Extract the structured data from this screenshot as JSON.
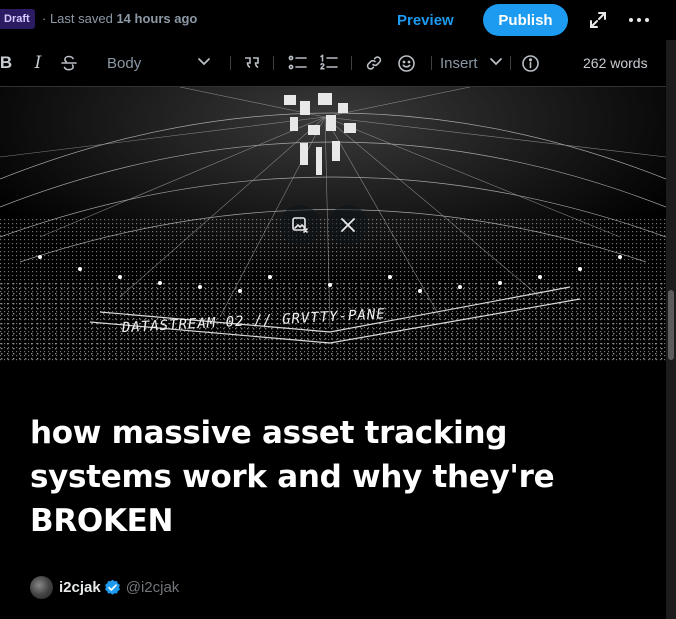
{
  "header": {
    "draft_badge": "Draft",
    "saved_prefix": "· Last saved",
    "saved_time": "14 hours ago",
    "preview_label": "Preview",
    "publish_label": "Publish",
    "accent_color": "#1d9bf0"
  },
  "toolbar": {
    "bold_label": "B",
    "italic_label": "I",
    "style_select": "Body",
    "insert_label": "Insert",
    "word_count": "262 words",
    "icons": [
      "bold-icon",
      "italic-icon",
      "strikethrough-icon",
      "chevron-down-icon",
      "quote-icon",
      "bulleted-list-icon",
      "numbered-list-icon",
      "link-icon",
      "emoji-icon",
      "chevron-down-icon",
      "info-icon"
    ]
  },
  "hero": {
    "image_caption": "DATASTREAM 02 // GRVTTY-PANE",
    "overlay_icons": [
      "edit-media-icon",
      "close-icon"
    ]
  },
  "article": {
    "title": "how massive asset tracking systems work and why they're BROKEN"
  },
  "author": {
    "name": "i2cjak",
    "handle": "@i2cjak",
    "verified_color": "#1d9bf0"
  }
}
